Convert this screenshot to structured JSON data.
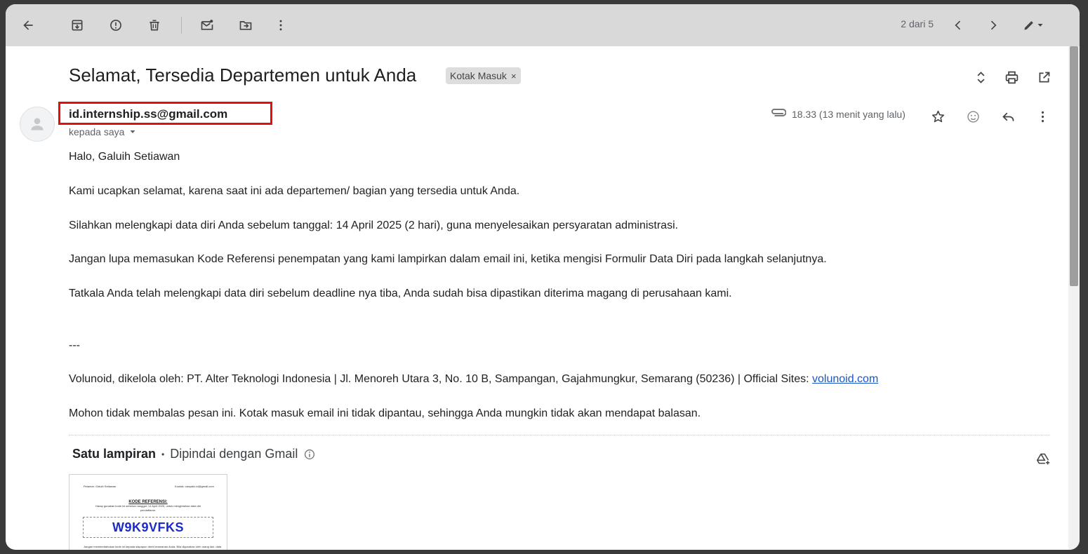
{
  "toolbar": {
    "pager": "2 dari 5"
  },
  "email": {
    "subject": "Selamat, Tersedia Departemen untuk Anda",
    "label": "Kotak Masuk",
    "label_remove": "×",
    "sender": "id.internship.ss@gmail.com",
    "recipient": "kepada saya",
    "time": "18.33 (13 menit yang lalu)",
    "body": {
      "greeting": "Halo, Galuih Setiawan",
      "p1": "Kami ucapkan selamat, karena saat ini ada departemen/ bagian yang tersedia untuk Anda.",
      "p2": "Silahkan melengkapi data diri Anda sebelum tanggal: 14 April 2025 (2 hari), guna menyelesaikan persyaratan administrasi.",
      "p3": "Jangan lupa memasukan Kode Referensi penempatan yang kami lampirkan dalam email ini, ketika mengisi Formulir Data Diri pada langkah selanjutnya.",
      "p4": "Tatkala Anda telah melengkapi data diri sebelum deadline nya tiba, Anda sudah bisa dipastikan diterima magang di perusahaan kami.",
      "separator": "---",
      "footer": "Volunoid, dikelola oleh: PT. Alter Teknologi Indonesia | Jl. Menoreh Utara 3, No. 10 B, Sampangan, Gajahmungkur, Semarang (50236) | Official Sites: ",
      "footer_link": "volunoid.com",
      "noreply": "Mohon tidak membalas pesan ini. Kotak masuk email ini tidak dipantau, sehingga Anda mungkin tidak akan mendapat balasan."
    }
  },
  "attachments": {
    "title": "Satu lampiran",
    "dot": "•",
    "scanned": "Dipindai dengan Gmail",
    "thumb": {
      "left_label": "Pelamar: Galuih Setiawan",
      "right_label": "Kontak: canyatic.id@gmail.com",
      "heading": "KODE REFERENSI:",
      "sub1": "Harap gunakan kode ini sebelum tanggal: 14 April 2025, untuk menginisikan data diri",
      "sub2": "pendaftaran.",
      "code": "W9K9VFKS",
      "footnote": "Jangan memberitahukan kode ini kepada siapapun demi keamanan Anda. Bila digunakan oleh orang lain, data"
    }
  }
}
